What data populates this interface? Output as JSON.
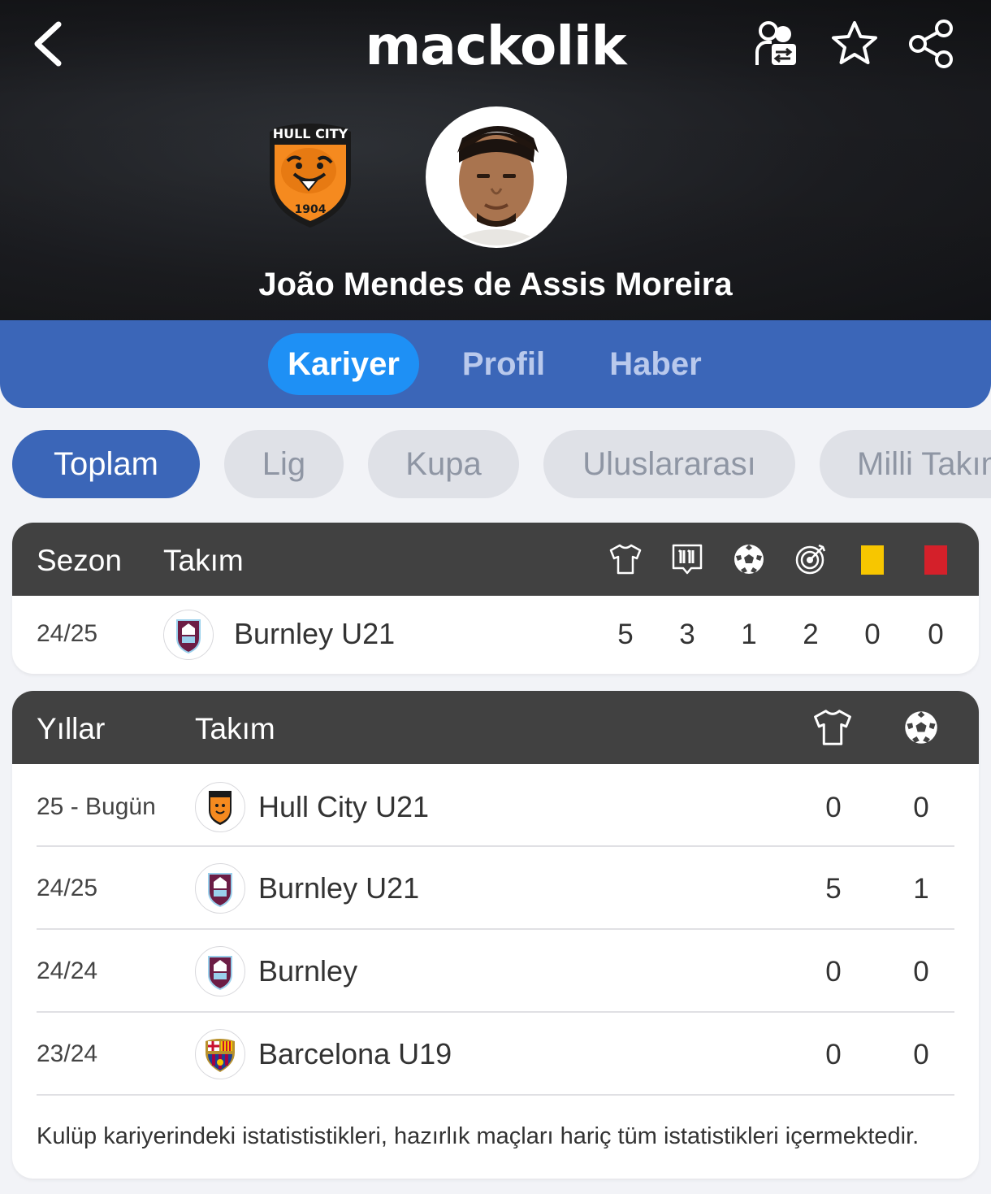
{
  "header": {
    "brand": "mackolik",
    "player_name": "João Mendes de Assis Moreira"
  },
  "main_tabs": [
    {
      "label": "Kariyer",
      "active": true
    },
    {
      "label": "Profil",
      "active": false
    },
    {
      "label": "Haber",
      "active": false
    }
  ],
  "filters": [
    {
      "label": "Toplam",
      "active": true
    },
    {
      "label": "Lig",
      "active": false
    },
    {
      "label": "Kupa",
      "active": false
    },
    {
      "label": "Uluslararası",
      "active": false
    },
    {
      "label": "Milli Takım",
      "active": false
    }
  ],
  "season_table": {
    "headers": {
      "season": "Sezon",
      "team": "Takım"
    },
    "stat_icons": [
      "shirt-icon",
      "lineup-eleven-icon",
      "ball-icon",
      "target-icon",
      "yellow-card-icon",
      "red-card-icon"
    ],
    "rows": [
      {
        "season": "24/25",
        "team": "Burnley U21",
        "logo": "burnley-crest",
        "stats": [
          "5",
          "3",
          "1",
          "2",
          "0",
          "0"
        ]
      }
    ]
  },
  "career_table": {
    "headers": {
      "years": "Yıllar",
      "team": "Takım"
    },
    "stat_icons": [
      "shirt-icon",
      "ball-icon"
    ],
    "rows": [
      {
        "years": "25 - Bugün",
        "team": "Hull City U21",
        "logo": "hull-city-crest",
        "apps": "0",
        "goals": "0"
      },
      {
        "years": "24/25",
        "team": "Burnley U21",
        "logo": "burnley-crest",
        "apps": "5",
        "goals": "1"
      },
      {
        "years": "24/24",
        "team": "Burnley",
        "logo": "burnley-crest",
        "apps": "0",
        "goals": "0"
      },
      {
        "years": "23/24",
        "team": "Barcelona U19",
        "logo": "barcelona-crest",
        "apps": "0",
        "goals": "0"
      }
    ],
    "footnote": "Kulüp kariyerindeki istatististikleri, hazırlık maçları hariç tüm istatistikleri içermektedir."
  },
  "colors": {
    "primary_blue": "#3b66b8",
    "active_tab": "#1e90f5",
    "table_header": "#414141",
    "yellow_card": "#f7c600",
    "red_card": "#d4202a"
  }
}
